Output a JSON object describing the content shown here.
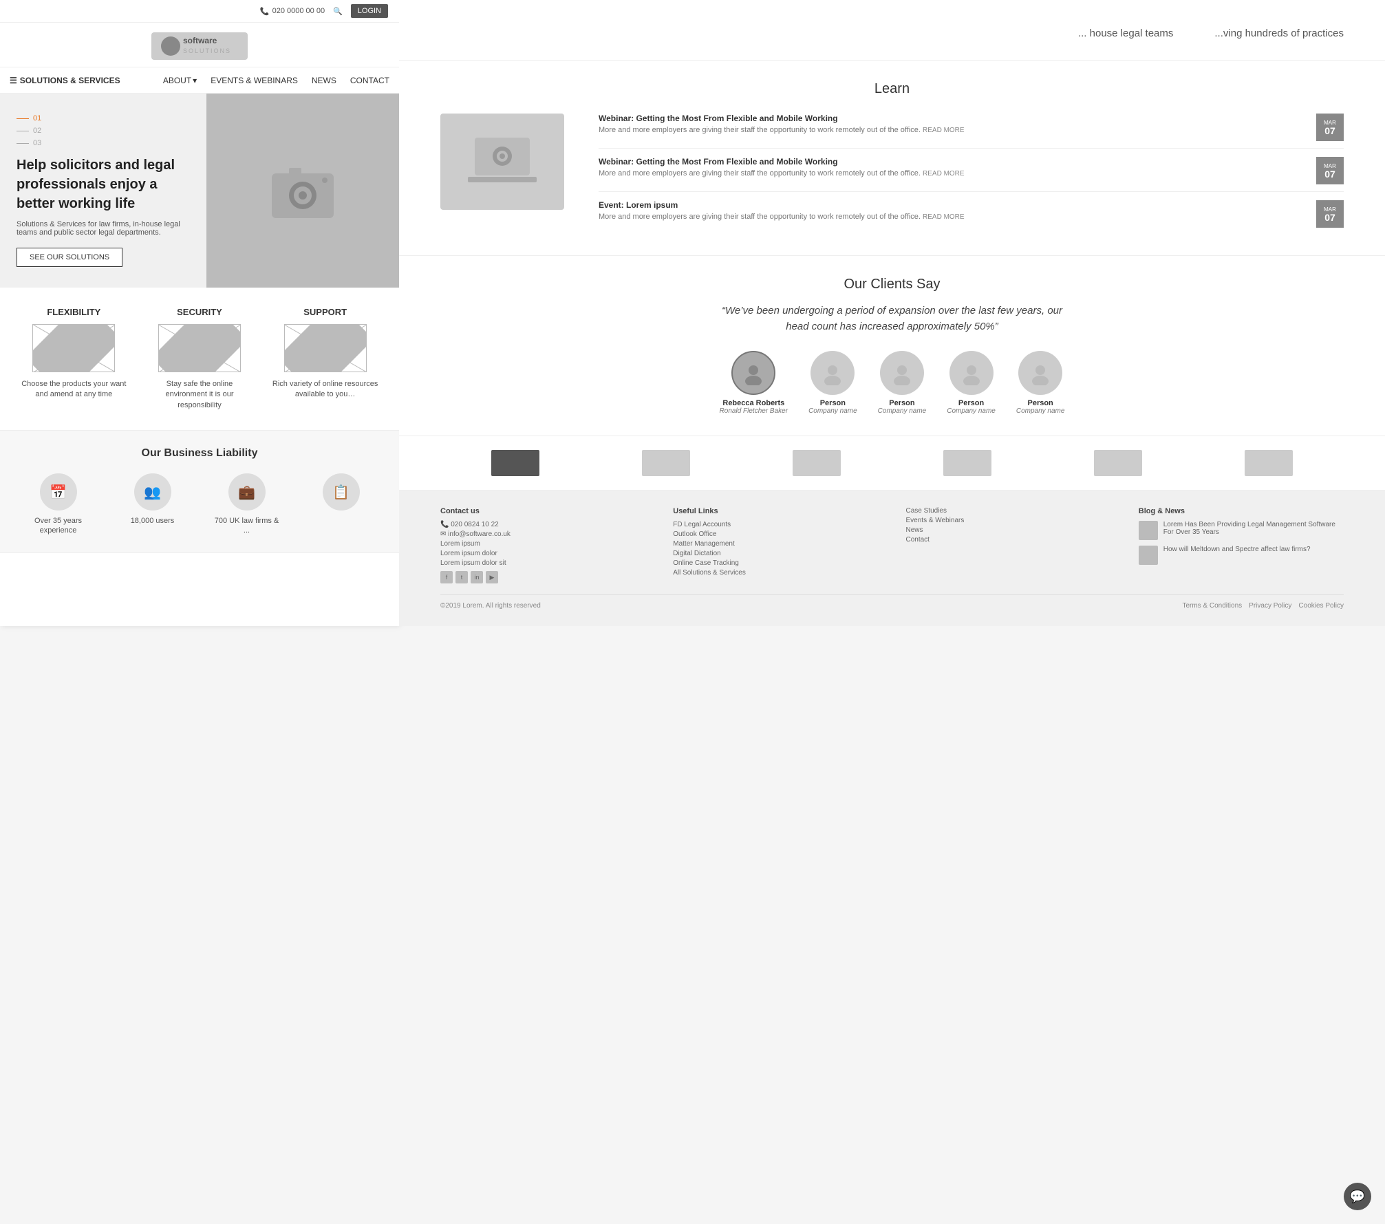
{
  "topbar": {
    "phone": "020 0000 00 00",
    "search_icon": "search",
    "login_label": "LOGIN"
  },
  "nav": {
    "solutions_label": "SOLUTIONS & SERVICES",
    "links": [
      {
        "label": "ABOUT",
        "has_dropdown": true
      },
      {
        "label": "EVENTS & WEBINARS"
      },
      {
        "label": "NEWS"
      },
      {
        "label": "CONTACT"
      }
    ]
  },
  "hero": {
    "slide_indicators": [
      "01",
      "02",
      "03"
    ],
    "active_slide": "01",
    "title": "Help solicitors and legal professionals enjoy a better working life",
    "subtitle": "Solutions & Services for law firms, in-house legal teams and public sector legal departments.",
    "cta_label": "SEE OUR SOLUTIONS"
  },
  "features": [
    {
      "title": "FLEXIBILITY",
      "description": "Choose the products your want and amend at any time"
    },
    {
      "title": "SECURITY",
      "description": "Stay safe the online environment it is our responsibility"
    },
    {
      "title": "SUPPORT",
      "description": "Rich variety of online resources available to you…"
    }
  ],
  "stats": {
    "title": "Our Business Liability",
    "items": [
      {
        "icon": "📅",
        "label": "Over 35 years experience"
      },
      {
        "icon": "👥",
        "label": "18,000 users"
      },
      {
        "icon": "💼",
        "label": "700 UK law firms & ..."
      },
      {
        "icon": "📋",
        "label": ""
      }
    ]
  },
  "partial_banner": {
    "text1": "... house legal teams",
    "text2": "...ving hundreds of practices"
  },
  "learn": {
    "title": "Learn",
    "events": [
      {
        "title": "Webinar: Getting the Most From Flexible and Mobile Working",
        "description": "More and more employers are giving their staff the opportunity to work remotely out of the office.",
        "read_more": "READ MORE",
        "month": "MAR",
        "day": "07"
      },
      {
        "title": "Webinar: Getting the Most From Flexible and Mobile Working",
        "description": "More and more employers are giving their staff the opportunity to work remotely out of the office.",
        "read_more": "READ MORE",
        "month": "MAR",
        "day": "07"
      },
      {
        "title": "Event: Lorem ipsum",
        "description": "More and more employers are giving their staff the opportunity to work remotely out of the office.",
        "read_more": "READ MORE",
        "month": "MAR",
        "day": "07"
      }
    ]
  },
  "clients": {
    "title": "Our Clients Say",
    "quote": "“We’ve been undergoing a period of expansion over the last few years, our head count has increased approximately 50%”",
    "people": [
      {
        "name": "Rebecca Roberts",
        "company": "Ronald Fletcher Baker",
        "active": true
      },
      {
        "name": "Person",
        "company": "Company name",
        "active": false
      },
      {
        "name": "Person",
        "company": "Company name",
        "active": false
      },
      {
        "name": "Person",
        "company": "Company name",
        "active": false
      },
      {
        "name": "Person",
        "company": "Company name",
        "active": false
      }
    ]
  },
  "footer": {
    "contact_title": "Contact us",
    "useful_links_title": "Useful Links",
    "blog_title": "Blog & News",
    "useful_links": [
      "FD Legal Accounts",
      "Outlook Office",
      "Matter Management",
      "Digital Dictation",
      "Online Case Tracking",
      "All Solutions & Services"
    ],
    "case_study_links": [
      "Case Studies",
      "Events & Webinars",
      "News",
      "Contact"
    ],
    "blog_items": [
      {
        "text": "Lorem Has Been Providing Legal Management Software For Over 35 Years"
      },
      {
        "text": "How will Meltdown and Spectre affect law firms?"
      }
    ],
    "copyright": "©2019 Lorem. All rights reserved",
    "bottom_links": [
      "Terms & Conditions",
      "Privacy Policy",
      "Cookies Policy"
    ]
  }
}
